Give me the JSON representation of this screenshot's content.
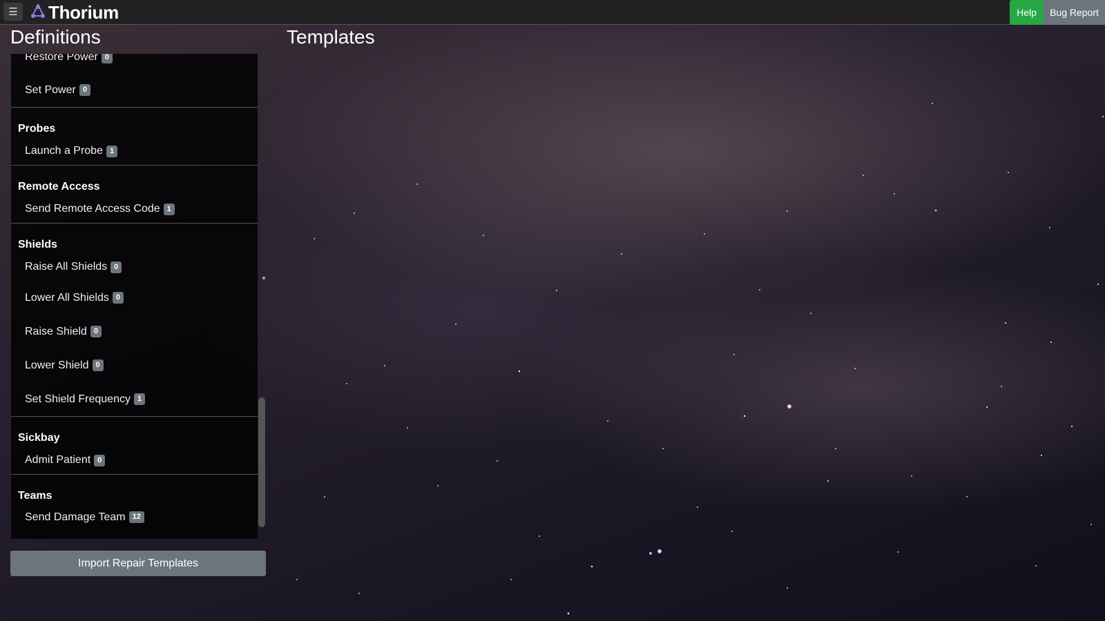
{
  "header": {
    "brand": "Thorium",
    "menu_icon": "hamburger-icon",
    "logo_icon": "thorium-logo-icon",
    "help_label": "Help",
    "bug_report_label": "Bug Report"
  },
  "definitions": {
    "title": "Definitions",
    "groups": [
      {
        "name": "",
        "items": [
          {
            "label": "Restore Power",
            "count": "0"
          },
          {
            "label": "Set Power",
            "count": "0"
          }
        ]
      },
      {
        "name": "Probes",
        "items": [
          {
            "label": "Launch a Probe",
            "count": "1"
          }
        ]
      },
      {
        "name": "Remote Access",
        "items": [
          {
            "label": "Send Remote Access Code",
            "count": "1"
          }
        ]
      },
      {
        "name": "Shields",
        "items": [
          {
            "label": "Raise All Shields",
            "count": "0"
          },
          {
            "label": "Lower All Shields",
            "count": "0"
          },
          {
            "label": "Raise Shield",
            "count": "0"
          },
          {
            "label": "Lower Shield",
            "count": "0"
          },
          {
            "label": "Set Shield Frequency",
            "count": "1"
          }
        ]
      },
      {
        "name": "Sickbay",
        "items": [
          {
            "label": "Admit Patient",
            "count": "0"
          }
        ]
      },
      {
        "name": "Teams",
        "items": [
          {
            "label": "Send Damage Team",
            "count": "12"
          }
        ]
      }
    ],
    "import_label": "Import Repair Templates"
  },
  "templates": {
    "title": "Templates"
  },
  "colors": {
    "help": "#28a745",
    "bug_report": "#6c757d",
    "badge": "#6c757d",
    "topbar": "#222222"
  }
}
